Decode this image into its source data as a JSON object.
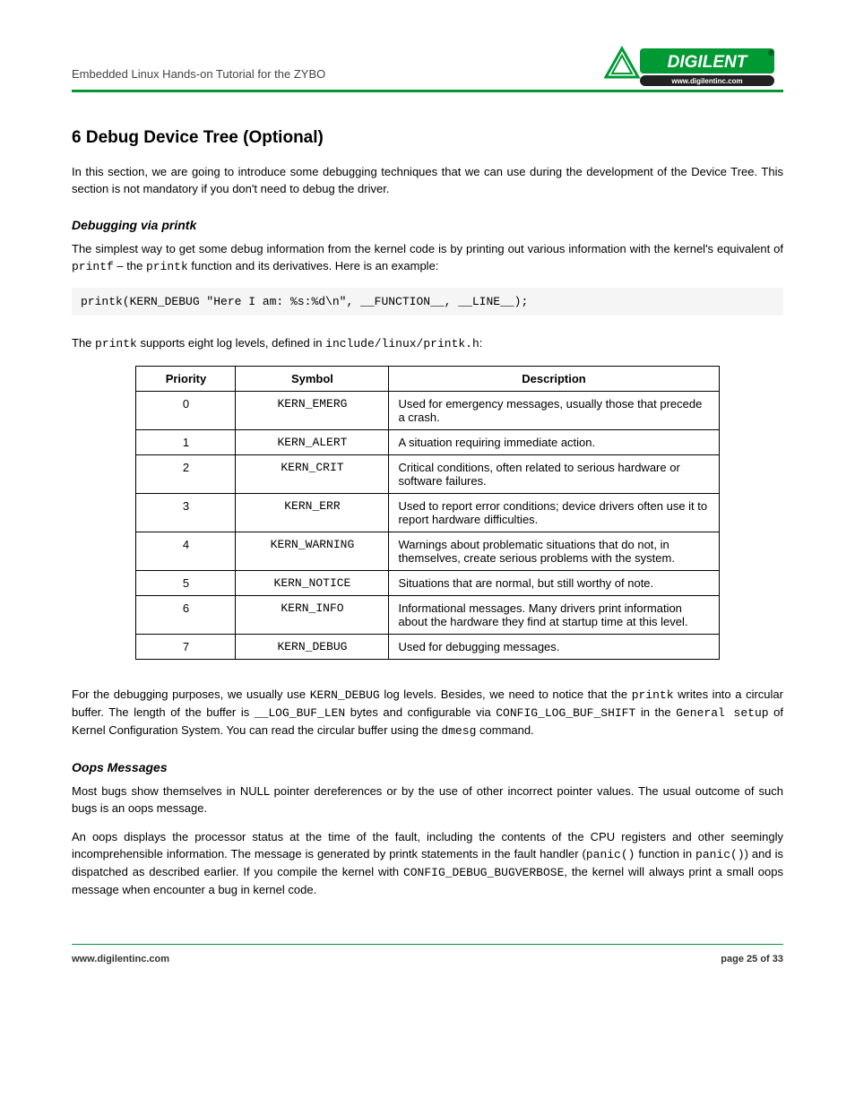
{
  "header": {
    "title": "Embedded Linux Hands-on Tutorial for the ZYBO",
    "logo_text_main": "DIGILENT",
    "logo_text_sub": "www.digilentinc.com",
    "logo_r": "®"
  },
  "section": {
    "title": "6    Debug Device Tree (Optional)",
    "intro": "In this section, we are going to introduce some debugging techniques that we can use during the development of the Device Tree. This section is not mandatory if you don't need to debug the driver."
  },
  "sub1": {
    "title": "Debugging via printk",
    "p1_pre": "The simplest way to get some debug information from the kernel code is by printing out various information with the kernel's equivalent of ",
    "p1_code1": "printf",
    "p1_mid": " – the ",
    "p1_code2": "printk",
    "p1_post": " function and its derivatives. Here is an example:"
  },
  "example": "printk(KERN_DEBUG \"Here I am: %s:%d\\n\", __FUNCTION__, __LINE__);",
  "levels_intro_pre": "The ",
  "levels_intro_code1": "printk",
  "levels_intro_mid": " supports eight log levels, defined in ",
  "levels_intro_code2": "include/linux/printk.h",
  "levels_intro_post": ":",
  "table": {
    "h1": "Priority",
    "h2": "Symbol",
    "h3": "Description",
    "rows": [
      {
        "p": "0",
        "s": "KERN_EMERG",
        "d": "Used for emergency messages, usually those that precede a crash."
      },
      {
        "p": "1",
        "s": "KERN_ALERT",
        "d": "A situation requiring immediate action."
      },
      {
        "p": "2",
        "s": "KERN_CRIT",
        "d": "Critical conditions, often related to serious hardware or software failures."
      },
      {
        "p": "3",
        "s": "KERN_ERR",
        "d": "Used to report error conditions; device drivers often use it to report hardware difficulties."
      },
      {
        "p": "4",
        "s": "KERN_WARNING",
        "d": "Warnings about problematic situations that do not, in themselves, create serious problems with the system."
      },
      {
        "p": "5",
        "s": "KERN_NOTICE",
        "d": "Situations that are normal, but still worthy of note."
      },
      {
        "p": "6",
        "s": "KERN_INFO",
        "d": "Informational messages. Many drivers print information about the hardware they find at startup time at this level."
      },
      {
        "p": "7",
        "s": "KERN_DEBUG",
        "d": "Used for debugging messages."
      }
    ]
  },
  "after_table": {
    "p1": "For the debugging purposes, we usually use ",
    "c1": "KERN_DEBUG",
    "p2": " log levels. Besides, we need to notice that the ",
    "c2": "printk",
    "p3": " writes into a circular buffer. The length of the buffer is ",
    "c3": "__LOG_BUF_LEN",
    "p4": " bytes and configurable via ",
    "c4": "CONFIG_LOG_BUF_SHIFT",
    "p5": " in the ",
    "c5": "General setup",
    "p6": " of Kernel Configuration System. You can read the circular buffer using the ",
    "c6": "dmesg",
    "p7": " command."
  },
  "sub2": {
    "title": "Oops Messages",
    "p1": "Most bugs show themselves in NULL pointer dereferences or by the use of other incorrect pointer values. The usual outcome of such bugs is an oops message.",
    "p2_pre": "An oops displays the processor status at the time of the fault, including the contents of the CPU registers and other seemingly incomprehensible information. The message is generated by printk statements in the fault handler (",
    "p2_code1": "panic()",
    "p2_mid": " function in ",
    "p2_code2": "panic()",
    "p2_post": ") and is dispatched as described earlier. If you compile the kernel with ",
    "p2_code3": "CONFIG_DEBUG_BUGVERBOSE",
    "p2_after": ", the kernel will always print a small oops message when encounter a bug in kernel code."
  },
  "footer": {
    "left": "www.digilentinc.com",
    "right": "page 25 of 33"
  }
}
